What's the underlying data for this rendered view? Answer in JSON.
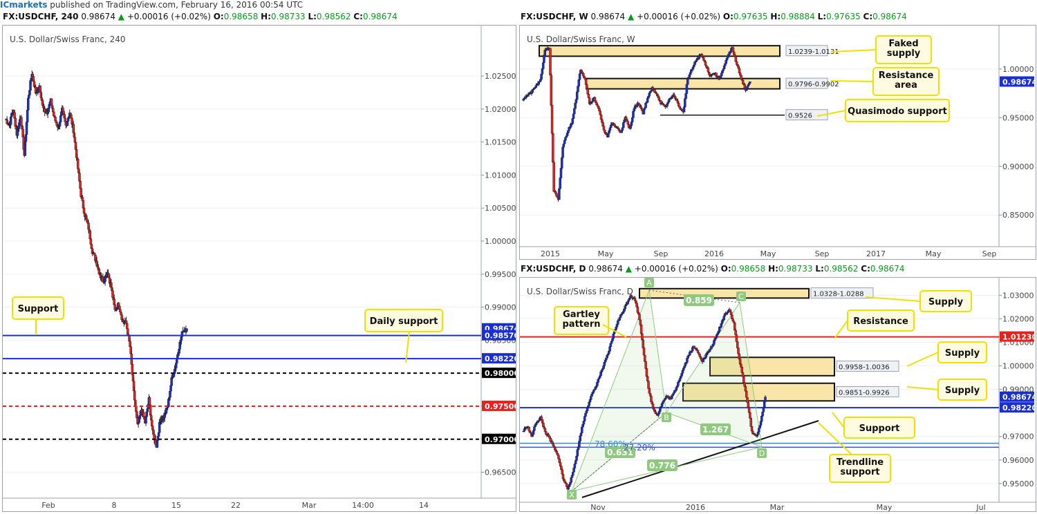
{
  "publisher": {
    "user": "ICmarkets",
    "text": " published on TradingView.com, February 16, 2016 00:54 UTC"
  },
  "panels": {
    "h4": {
      "symbol": "FX:USDCHF, 240",
      "last": "0.98674",
      "chg": "+0.00016 (+0.02%)",
      "o": "0.98658",
      "h": "0.98733",
      "l": "0.98562",
      "c": "0.98674",
      "title": "U.S. Dollar/Swiss Franc, 240"
    },
    "weekly": {
      "symbol": "FX:USDCHF, W",
      "last": "0.98674",
      "chg": "+0.00016 (+0.02%)",
      "o": "0.97635",
      "h": "0.98884",
      "l": "0.97635",
      "c": "0.98674",
      "title": "U.S. Dollar/Swiss Franc, W"
    },
    "daily": {
      "symbol": "FX:USDCHF, D",
      "last": "0.98674",
      "chg": "+0.00016 (+0.02%)",
      "o": "0.98658",
      "h": "0.98733",
      "l": "0.98562",
      "c": "0.98674",
      "title": "U.S. Dollar/Swiss Franc, D"
    }
  },
  "chart_data": [
    {
      "id": "h4",
      "type": "candlestick",
      "title": "U.S. Dollar/Swiss Franc, 240",
      "ylim": [
        0.9615,
        1.0295
      ],
      "x_ticks": [
        "Feb",
        "8",
        "15",
        "22",
        "Mar",
        "14:00",
        "14"
      ],
      "y_ticks": [
        "1.02500",
        "1.02000",
        "1.01500",
        "1.01000",
        "1.00500",
        "1.00000",
        "0.99500",
        "0.99000",
        "0.98500",
        "0.98000",
        "0.97500",
        "0.97000",
        "0.96500"
      ],
      "price_tags": [
        {
          "label": "0.98674",
          "value": 0.98674,
          "color": "#1a2fd0"
        },
        {
          "label": "0.98570",
          "value": 0.9857,
          "color": "#1a2fd0"
        },
        {
          "label": "0.98220",
          "value": 0.9822,
          "color": "#1a2fd0"
        },
        {
          "label": "0.98000",
          "value": 0.98,
          "color": "#000000"
        },
        {
          "label": "0.97500",
          "value": 0.975,
          "color": "#e8211c"
        },
        {
          "label": "0.97000",
          "value": 0.97,
          "color": "#000000"
        }
      ],
      "levels": [
        {
          "value": 0.9857,
          "style": "solid",
          "color": "#1a2fd0"
        },
        {
          "value": 0.9822,
          "style": "solid",
          "color": "#1a2fd0"
        },
        {
          "value": 0.98,
          "style": "dashed",
          "color": "#000000"
        },
        {
          "value": 0.975,
          "style": "dashed",
          "color": "#e8211c"
        },
        {
          "value": 0.97,
          "style": "dashed",
          "color": "#000000"
        }
      ],
      "annotations": [
        {
          "text": "Support"
        },
        {
          "text": "Daily support"
        }
      ],
      "path": [
        1.0185,
        1.0175,
        1.02,
        1.0162,
        1.019,
        1.013,
        1.0215,
        1.0255,
        1.0225,
        1.0232,
        1.02,
        1.0196,
        1.0212,
        1.0185,
        1.0172,
        1.0198,
        1.0175,
        1.0195,
        1.0168,
        1.012,
        1.007,
        1.004,
        1.002,
        0.9985,
        0.997,
        0.995,
        0.994,
        0.9955,
        0.993,
        0.9895,
        0.9905,
        0.988,
        0.9875,
        0.984,
        0.977,
        0.972,
        0.9745,
        0.9725,
        0.976,
        0.971,
        0.969,
        0.973,
        0.9735,
        0.975,
        0.979,
        0.981,
        0.984,
        0.9865,
        0.98674
      ]
    },
    {
      "id": "weekly",
      "type": "candlestick",
      "title": "U.S. Dollar/Swiss Franc, W",
      "ylim": [
        0.8175,
        1.0375
      ],
      "x_ticks": [
        "2015",
        "May",
        "Sep",
        "2016",
        "May",
        "Sep",
        "2017",
        "May",
        "Sep"
      ],
      "y_ticks": [
        "1.00000",
        "0.95000",
        "0.90000",
        "0.85000"
      ],
      "price_tags": [
        {
          "label": "0.98674",
          "value": 0.98674,
          "color": "#1a2fd0"
        }
      ],
      "zones": [
        {
          "label": "1.0239-1.0131",
          "high": 1.0239,
          "low": 1.0131
        },
        {
          "label": "0.9796-0.9902",
          "high": 0.9902,
          "low": 0.9796
        }
      ],
      "levels": [
        {
          "label": "0.9526",
          "value": 0.9526
        }
      ],
      "annotations": [
        {
          "text": "Faked supply"
        },
        {
          "text": "Resistance area"
        },
        {
          "text": "Quasimodo support"
        }
      ],
      "path": [
        0.969,
        0.973,
        0.976,
        0.983,
        0.988,
        1.02,
        1.022,
        0.875,
        0.865,
        0.92,
        0.935,
        0.945,
        0.97,
        1.0,
        0.99,
        0.965,
        0.97,
        0.96,
        0.94,
        0.93,
        0.945,
        0.94,
        0.935,
        0.95,
        0.938,
        0.96,
        0.965,
        0.955,
        0.97,
        0.98,
        0.975,
        0.965,
        0.96,
        0.97,
        0.973,
        0.962,
        0.955,
        0.99,
        1.0,
        1.01,
        1.015,
        1.005,
        0.993,
        0.996,
        0.99,
        1.0,
        1.013,
        1.022,
        1.005,
        0.991,
        0.978,
        0.98674
      ]
    },
    {
      "id": "daily",
      "type": "candlestick",
      "title": "U.S. Dollar/Swiss Franc, D",
      "ylim": [
        0.9435,
        1.0345
      ],
      "x_ticks": [
        "Nov",
        "2016",
        "Mar",
        "May",
        "Jul"
      ],
      "y_ticks": [
        "1.03000",
        "1.02000",
        "1.01000",
        "1.00000",
        "0.99000",
        "0.97000",
        "0.96000",
        "0.95000"
      ],
      "price_tags": [
        {
          "label": "0.98674",
          "value": 0.98674,
          "color": "#1a2fd0"
        },
        {
          "label": "0.98220",
          "value": 0.9822,
          "color": "#1a2fd0"
        },
        {
          "label": "1.01230",
          "value": 1.0123,
          "color": "#e8211c"
        }
      ],
      "zones": [
        {
          "label": "1.0328-1.0288",
          "high": 1.0328,
          "low": 1.0288
        },
        {
          "label": "0.9958-1.0036",
          "high": 1.0036,
          "low": 0.9958
        },
        {
          "label": "0.9851-0.9926",
          "high": 0.9926,
          "low": 0.9851
        }
      ],
      "levels": [
        {
          "value": 1.0123,
          "color": "#e8211c"
        },
        {
          "value": 0.9822,
          "color": "#1a2fd0"
        },
        {
          "value": 0.9671,
          "color": "#2f89d8"
        },
        {
          "value": 0.9654,
          "color": "#3a4fd0"
        }
      ],
      "pattern_points": [
        "X",
        "A",
        "B",
        "C",
        "D"
      ],
      "ratios": [
        "0.859",
        "1.267",
        "0.631",
        "0.776",
        "78.60%",
        "27.20%"
      ],
      "annotations": [
        {
          "text": "Gartley pattern"
        },
        {
          "text": "Supply"
        },
        {
          "text": "Resistance"
        },
        {
          "text": "Supply"
        },
        {
          "text": "Supply"
        },
        {
          "text": "Support"
        },
        {
          "text": "Trendline support"
        }
      ],
      "path": [
        0.972,
        0.9745,
        0.97,
        0.976,
        0.978,
        0.972,
        0.969,
        0.965,
        0.961,
        0.952,
        0.948,
        0.953,
        0.962,
        0.972,
        0.98,
        0.986,
        0.99,
        0.995,
        1.0,
        1.005,
        1.012,
        1.018,
        1.022,
        1.026,
        1.03,
        1.028,
        1.02,
        1.005,
        0.99,
        0.982,
        0.979,
        0.984,
        0.987,
        0.986,
        0.99,
        0.995,
        1.0,
        1.005,
        1.008,
        1.006,
        1.002,
        1.005,
        1.008,
        1.012,
        1.017,
        1.022,
        1.024,
        1.018,
        1.005,
        0.995,
        0.985,
        0.972,
        0.97,
        0.976,
        0.98674
      ]
    }
  ]
}
